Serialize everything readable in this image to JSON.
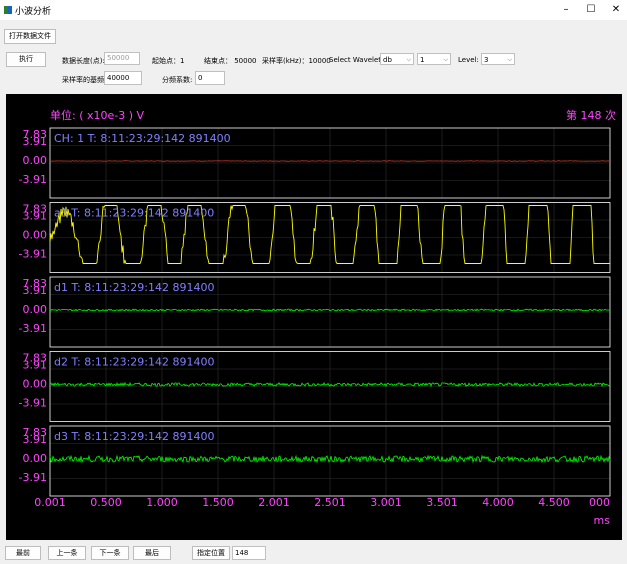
{
  "window": {
    "title": "小波分析",
    "minimize": "–",
    "maximize": "☐",
    "close": "✕"
  },
  "toolbar": {
    "open_file": "打开数据文件"
  },
  "controls": {
    "execute": "执行",
    "data_length_label": "数据长度(点):",
    "data_length_placeholder": "50000",
    "start_label": "起始点：1",
    "end_label": "结束点：  50000",
    "sample_rate_label": "采样率(kHz)：10000",
    "wavelet_label": "Select Wavelet:",
    "wavelet_value": "db",
    "wavelet_order": "1",
    "level_label": "Level:",
    "level_value": "3",
    "base_rate_label": "采样率的基频:",
    "base_rate_value": "40000",
    "divider_label": "分频系数:",
    "divider_value": "0"
  },
  "plot": {
    "unit_label": "单位: ( x10e-3 ) V",
    "count_label": "第 148 次",
    "y_ticks": [
      "7.83",
      "3.91",
      "0.00",
      "-3.91"
    ],
    "channels": [
      {
        "label": "CH:  1   T:  8:11:23:29:142 891400",
        "color": "#c0392b",
        "amp": 0.02
      },
      {
        "label": "a3 T:  8:11:23:29:142 891400",
        "color": "#ffff00",
        "amp": 0.85
      },
      {
        "label": "d1 T:  8:11:23:29:142 891400",
        "color": "#00ff00",
        "amp": 0.06
      },
      {
        "label": "d2 T:  8:11:23:29:142 891400",
        "color": "#00ff00",
        "amp": 0.12
      },
      {
        "label": "d3 T:  8:11:23:29:142 891400",
        "color": "#00ff00",
        "amp": 0.22
      }
    ],
    "x_ticks": [
      "0.001",
      "0.500",
      "1.000",
      "1.500",
      "2.001",
      "2.501",
      "3.001",
      "3.501",
      "4.000",
      "4.500",
      "000"
    ],
    "x_unit": "ms",
    "colors": {
      "label_text": "#8080ff",
      "axis_text": "#ff44ff",
      "frame": "#ffffff",
      "grid": "#2e2e2e"
    }
  },
  "bottom": {
    "first": "最前",
    "prev": "上一条",
    "next": "下一条",
    "last": "最后",
    "goto": "指定位置",
    "goto_value": "148"
  }
}
